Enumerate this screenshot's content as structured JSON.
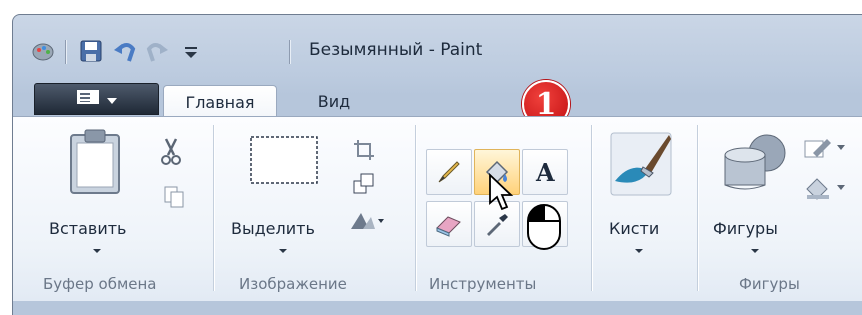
{
  "window": {
    "title": "Безымянный - Paint"
  },
  "quick_access": {
    "icons": [
      "paint-app-icon",
      "save-icon",
      "undo-icon",
      "redo-icon",
      "customize-qa-icon"
    ]
  },
  "tabs": [
    {
      "label": "Главная",
      "active": true
    },
    {
      "label": "Вид",
      "active": false
    }
  ],
  "callout": {
    "number": "1"
  },
  "groups": {
    "clipboard": {
      "label": "Буфер обмена",
      "paste_label": "Вставить"
    },
    "image": {
      "label": "Изображение",
      "select_label": "Выделить"
    },
    "tools": {
      "label": "Инструменты"
    },
    "brushes": {
      "label": "Кисти"
    },
    "shapes": {
      "label": "Фигуры",
      "shapes_label": "Фигуры"
    }
  },
  "colors": {
    "accent_red": "#d21a1e",
    "ribbon_bg": "#eef3f9",
    "hover": "#ffd27a"
  }
}
